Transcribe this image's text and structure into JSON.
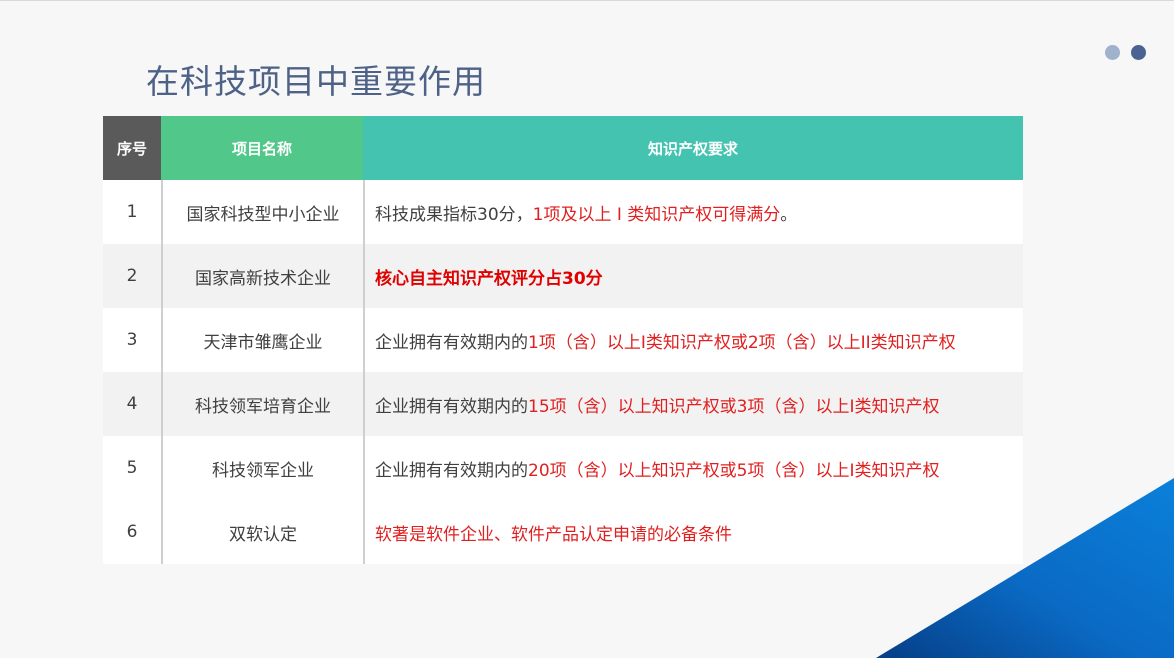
{
  "title": "在科技项目中重要作用",
  "colors": {
    "title": "#4e6287",
    "header_no": "#5a5a5a",
    "header_name": "#52c78a",
    "header_req": "#45c3b1",
    "highlight": "#e02020",
    "corner_blue": "#0a78d4"
  },
  "decor": {
    "dots": [
      "light-dot",
      "dark-dot"
    ],
    "corner": "blue-triangle"
  },
  "table": {
    "headers": {
      "no": "序号",
      "name": "项目名称",
      "requirement": "知识产权要求"
    },
    "rows": [
      {
        "no": "1",
        "name": "国家科技型中小企业",
        "req_plain": "科技成果指标30分，",
        "req_red": "1项及以上 Ⅰ 类知识产权可得满分",
        "req_tail": "。"
      },
      {
        "no": "2",
        "name": "国家高新技术企业",
        "req_plain": "",
        "req_red": "核心自主知识产权评分占30分",
        "req_tail": ""
      },
      {
        "no": "3",
        "name": "天津市雏鹰企业",
        "req_plain": "企业拥有有效期内的",
        "req_red": "1项（含）以上I类知识产权或2项（含）以上II类知识产权",
        "req_tail": ""
      },
      {
        "no": "4",
        "name": "科技领军培育企业",
        "req_plain": "企业拥有有效期内的",
        "req_red": "15项（含）以上知识产权或3项（含）以上I类知识产权",
        "req_tail": ""
      },
      {
        "no": "5",
        "name": "科技领军企业",
        "req_plain": "企业拥有有效期内的",
        "req_red": "20项（含）以上知识产权或5项（含）以上I类知识产权",
        "req_tail": ""
      },
      {
        "no": "6",
        "name": "双软认定",
        "req_plain": "",
        "req_red": "软著是软件企业、软件产品认定申请的必备条件",
        "req_tail": ""
      }
    ]
  }
}
